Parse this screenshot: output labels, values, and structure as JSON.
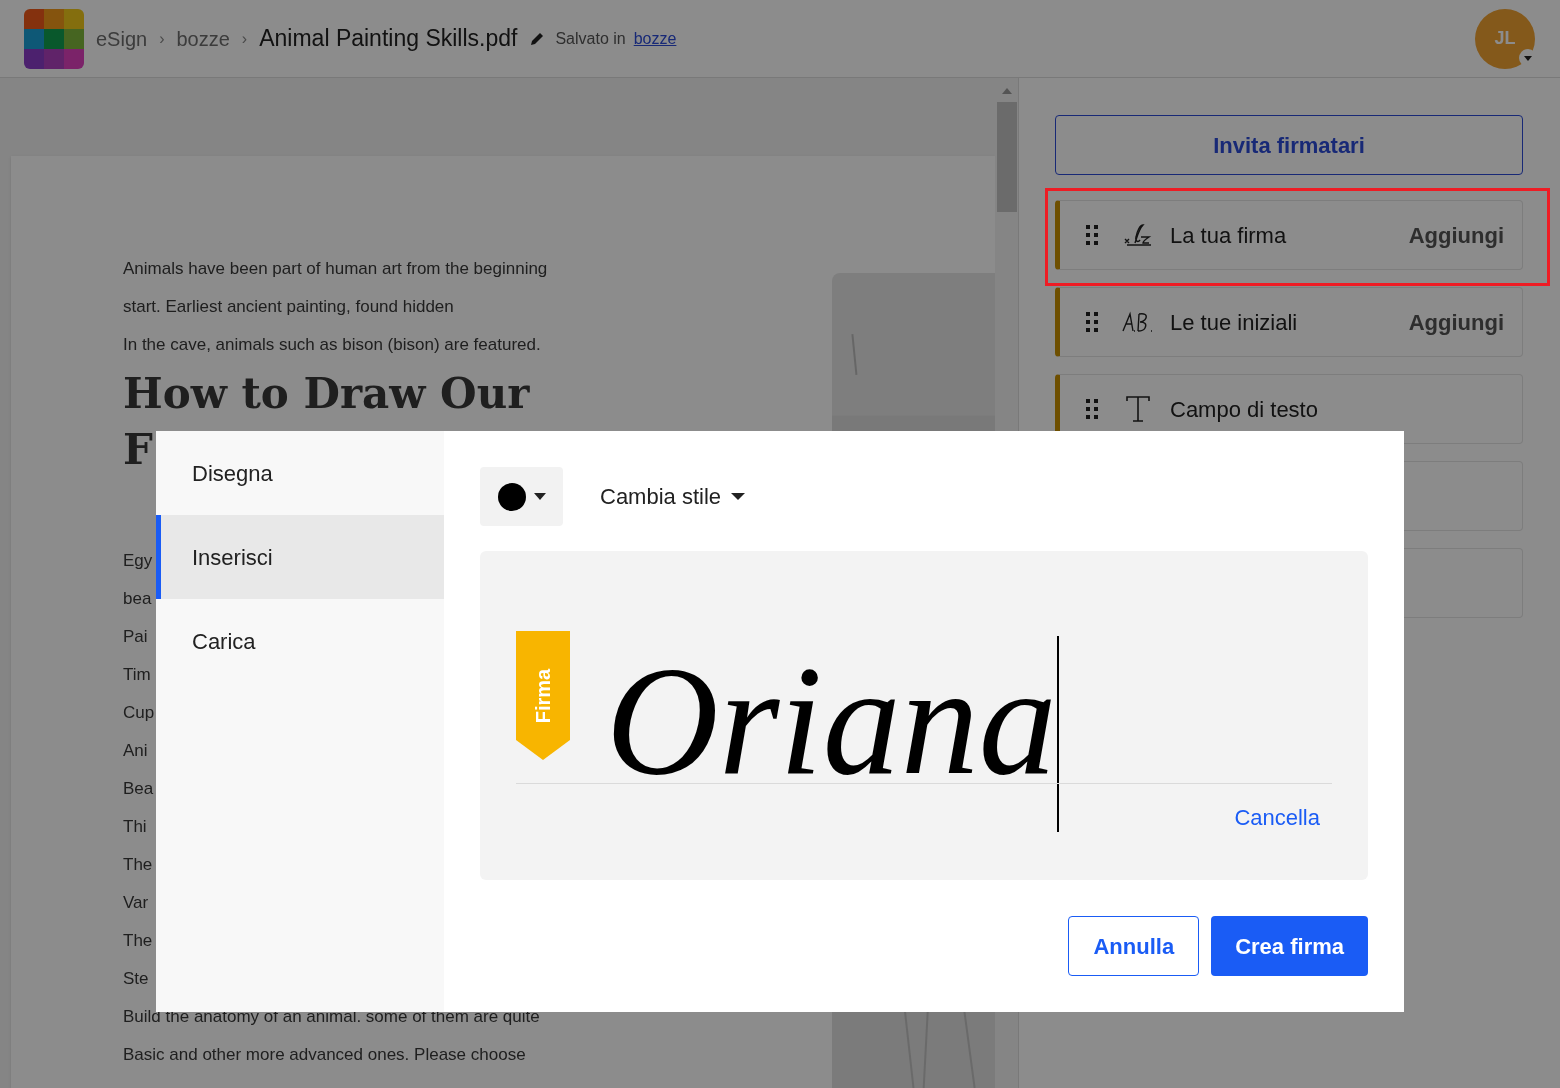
{
  "header": {
    "app": "eSign",
    "separator": "›",
    "folder": "bozze",
    "title": "Animal Painting Skills.pdf",
    "saved_label": "Salvato in",
    "saved_link": "bozze",
    "avatar": "JL"
  },
  "document": {
    "intro_lines": [
      "Animals have been part of human art from the beginning",
      "start. Earliest ancient painting, found hidden",
      "In the cave, animals such as bison (bison) are featured."
    ],
    "heading_lines": [
      "How to Draw Our",
      "F"
    ],
    "body_lines": [
      "Egy",
      "bea",
      "Pai",
      "Tim",
      "Cup",
      "Ani",
      "Bea",
      "Thi",
      "The",
      "Var",
      "The",
      "Ste",
      "Build the anatomy of an animal. some of them are quite",
      "Basic and other more advanced ones. Please choose"
    ]
  },
  "sidebar": {
    "invite_button": "Invita firmatari",
    "fields": [
      {
        "kind": "signature",
        "label": "La tua firma",
        "action": "Aggiungi",
        "highlighted": true
      },
      {
        "kind": "initials",
        "label": "Le tue iniziali",
        "action": "Aggiungi",
        "highlighted": false
      },
      {
        "kind": "text",
        "label": "Campo di testo",
        "highlighted": false
      },
      {
        "kind": "blank",
        "highlighted": false
      },
      {
        "kind": "blank",
        "highlighted": false
      }
    ]
  },
  "modal": {
    "tabs": [
      {
        "label": "Disegna",
        "selected": false
      },
      {
        "label": "Inserisci",
        "selected": true
      },
      {
        "label": "Carica",
        "selected": false
      }
    ],
    "color_button": {
      "color": "#000000"
    },
    "style_menu": "Cambia stile",
    "ribbon": "Firma",
    "signature": "Oriana",
    "clear_link": "Cancella",
    "buttons": [
      {
        "label": "Annulla",
        "kind": "secondary"
      },
      {
        "label": "Crea firma",
        "kind": "primary"
      }
    ]
  }
}
